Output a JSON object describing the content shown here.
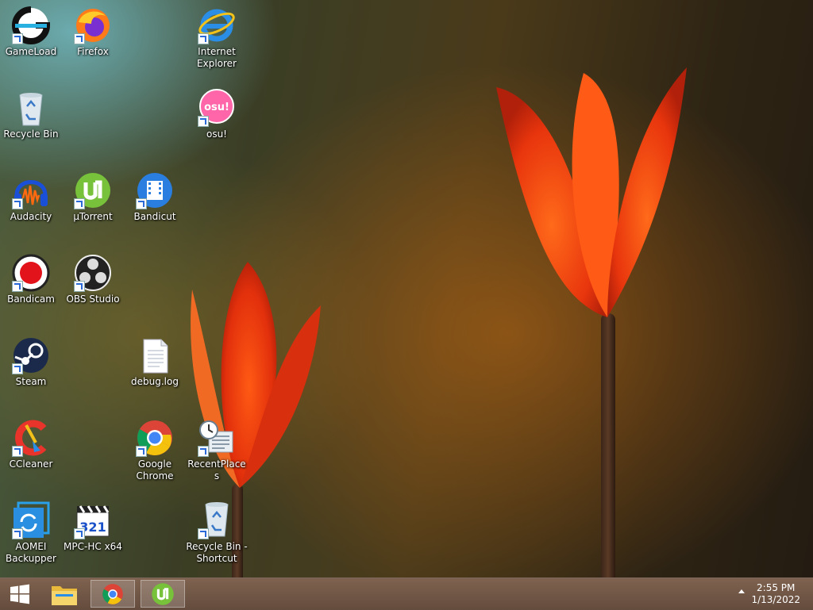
{
  "desktop": {
    "icons": [
      {
        "name": "GameLoad",
        "icon": "gameload-icon",
        "shortcut": true
      },
      {
        "name": "Firefox",
        "icon": "firefox-icon",
        "shortcut": true
      },
      {
        "name": "Internet Explorer",
        "icon": "internet-explorer-icon",
        "shortcut": true
      },
      {
        "name": "Recycle Bin",
        "icon": "recycle-bin-icon",
        "shortcut": false
      },
      {
        "name": "osu!",
        "icon": "osu-icon",
        "shortcut": true
      },
      {
        "name": "Audacity",
        "icon": "audacity-icon",
        "shortcut": true
      },
      {
        "name": "µTorrent",
        "icon": "utorrent-icon",
        "shortcut": true
      },
      {
        "name": "Bandicut",
        "icon": "bandicut-icon",
        "shortcut": true
      },
      {
        "name": "Bandicam",
        "icon": "bandicam-icon",
        "shortcut": true
      },
      {
        "name": "OBS Studio",
        "icon": "obs-studio-icon",
        "shortcut": true
      },
      {
        "name": "Steam",
        "icon": "steam-icon",
        "shortcut": true
      },
      {
        "name": "debug.log",
        "icon": "text-file-icon",
        "shortcut": false
      },
      {
        "name": "CCleaner",
        "icon": "ccleaner-icon",
        "shortcut": true
      },
      {
        "name": "Google Chrome",
        "icon": "chrome-icon",
        "shortcut": true
      },
      {
        "name": "RecentPlaces",
        "icon": "recent-places-icon",
        "shortcut": true
      },
      {
        "name": "AOMEI Backupper",
        "icon": "aomei-backupper-icon",
        "shortcut": true
      },
      {
        "name": "MPC-HC x64",
        "icon": "mpc-hc-icon",
        "shortcut": true
      },
      {
        "name": "Recycle Bin - Shortcut",
        "icon": "recycle-bin-icon",
        "shortcut": true
      }
    ]
  },
  "taskbar": {
    "start_icon": "windows-start-icon",
    "pinned": [
      {
        "icon": "file-explorer-icon",
        "active": false
      },
      {
        "icon": "chrome-icon",
        "active": true
      },
      {
        "icon": "utorrent-icon",
        "active": true
      }
    ],
    "clock": {
      "time": "2:55 PM",
      "date": "1/13/2022"
    }
  },
  "colors": {
    "taskbar": "#6e5242",
    "shortcut_arrow": "#2a6bd8"
  }
}
